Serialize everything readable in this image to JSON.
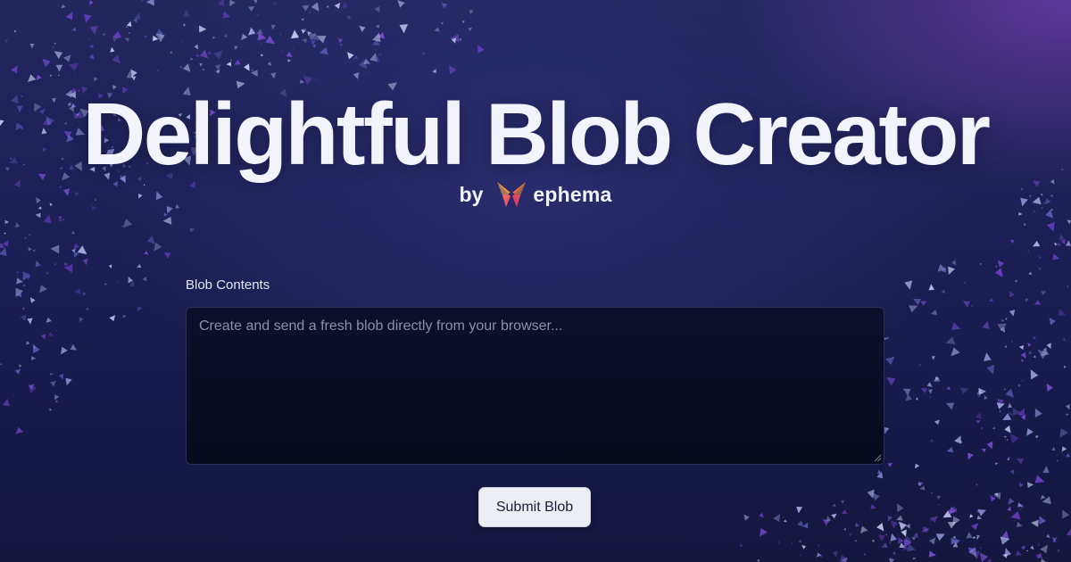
{
  "hero": {
    "title": "Delightful Blob Creator",
    "by_text": "by",
    "brand_name": "ephema"
  },
  "form": {
    "label": "Blob Contents",
    "placeholder": "Create and send a fresh blob directly from your browser...",
    "submit_label": "Submit Blob"
  },
  "colors": {
    "background": "#1d2058",
    "accent_purple": "#6e3caa",
    "button_bg": "#eceef3",
    "logo_orange": "#f2743a",
    "logo_pink": "#e8407a"
  },
  "icons": {
    "brand_logo": "butterfly-logo-icon",
    "resize_handle": "resize-grip-icon"
  }
}
